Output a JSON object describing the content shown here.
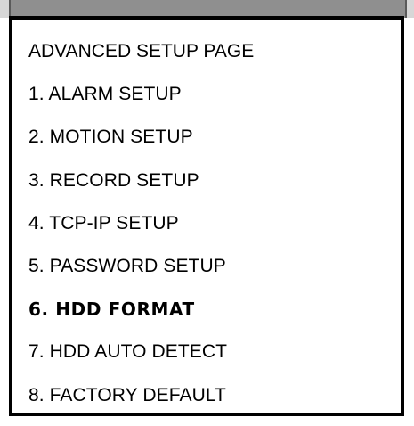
{
  "menu": {
    "title": "ADVANCED SETUP PAGE",
    "items": [
      {
        "label": "1. ALARM SETUP",
        "selected": false
      },
      {
        "label": "2. MOTION SETUP",
        "selected": false
      },
      {
        "label": "3. RECORD SETUP",
        "selected": false
      },
      {
        "label": "4. TCP-IP SETUP",
        "selected": false
      },
      {
        "label": "5. PASSWORD SETUP",
        "selected": false
      },
      {
        "label": "6. HDD FORMAT",
        "selected": true
      },
      {
        "label": "7. HDD AUTO DETECT",
        "selected": false
      },
      {
        "label": "8. FACTORY DEFAULT",
        "selected": false
      }
    ]
  },
  "colors": {
    "panel_border": "#000000",
    "top_bar": "#8f8f8f",
    "background": "#ffffff"
  }
}
